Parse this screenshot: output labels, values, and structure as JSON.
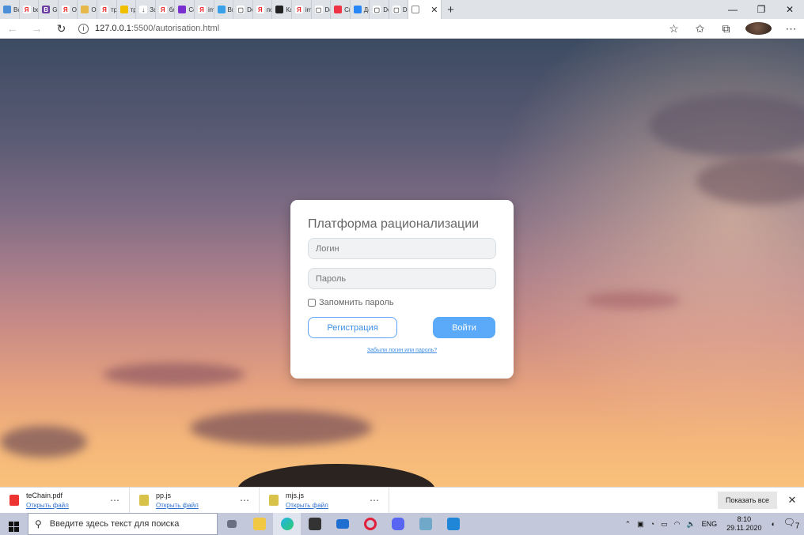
{
  "browser": {
    "tabs": [
      {
        "label": "Все",
        "color": "#4a8fd8",
        "glyph": ""
      },
      {
        "label": "bo",
        "color": "#fff",
        "glyph": "Я",
        "gcolor": "#e22"
      },
      {
        "label": "Gri",
        "color": "#6b3fa0",
        "glyph": "B"
      },
      {
        "label": "Оп",
        "color": "#fff",
        "glyph": "Я",
        "gcolor": "#e22"
      },
      {
        "label": "Оп",
        "color": "#e6b84a",
        "glyph": ""
      },
      {
        "label": "тр",
        "color": "#fff",
        "glyph": "Я",
        "gcolor": "#e22"
      },
      {
        "label": "тр",
        "color": "#f0c000",
        "glyph": ""
      },
      {
        "label": "За",
        "color": "#fff",
        "glyph": "↓",
        "gcolor": "#333"
      },
      {
        "label": "бл",
        "color": "#fff",
        "glyph": "Я",
        "gcolor": "#e22"
      },
      {
        "label": "Се",
        "color": "#7a2fd0",
        "glyph": ""
      },
      {
        "label": "im",
        "color": "#fff",
        "glyph": "Я",
        "gcolor": "#e22"
      },
      {
        "label": "Вы",
        "color": "#3aa0e8",
        "glyph": ""
      },
      {
        "label": "Do",
        "color": "#fff",
        "glyph": "▢",
        "gcolor": "#555"
      },
      {
        "label": "по",
        "color": "#fff",
        "glyph": "Я",
        "gcolor": "#e22"
      },
      {
        "label": "Ка",
        "color": "#222",
        "glyph": ""
      },
      {
        "label": "im",
        "color": "#fff",
        "glyph": "Я",
        "gcolor": "#e22"
      },
      {
        "label": "Do",
        "color": "#fff",
        "glyph": "▢",
        "gcolor": "#555"
      },
      {
        "label": "Сп",
        "color": "#e34",
        "glyph": ""
      },
      {
        "label": "До",
        "color": "#2787f5",
        "glyph": ""
      },
      {
        "label": "Do",
        "color": "#fff",
        "glyph": "▢",
        "gcolor": "#555"
      },
      {
        "label": "Do",
        "color": "#fff",
        "glyph": "▢",
        "gcolor": "#555"
      }
    ],
    "url_host": "127.0.0.1",
    "url_path": ":5500/autorisation.html"
  },
  "login": {
    "title": "Платформа рационализации",
    "login_placeholder": "Логин",
    "password_placeholder": "Пароль",
    "remember_label": "Запомнить пароль",
    "register_label": "Регистрация",
    "signin_label": "Войти",
    "forgot_label": "Забыли логин или пароль?"
  },
  "downloads": {
    "items": [
      {
        "name": "teChain.pdf",
        "action": "Открыть файл",
        "color": "#e33"
      },
      {
        "name": "pp.js",
        "action": "Открыть файл",
        "color": "#d8c24a"
      },
      {
        "name": "mjs.js",
        "action": "Открыть файл",
        "color": "#d8c24a"
      }
    ],
    "show_all": "Показать все"
  },
  "taskbar": {
    "search_placeholder": "Введите здесь текст для поиска",
    "language": "ENG",
    "time": "8:10",
    "date": "29.11.2020",
    "notifications": "7"
  }
}
